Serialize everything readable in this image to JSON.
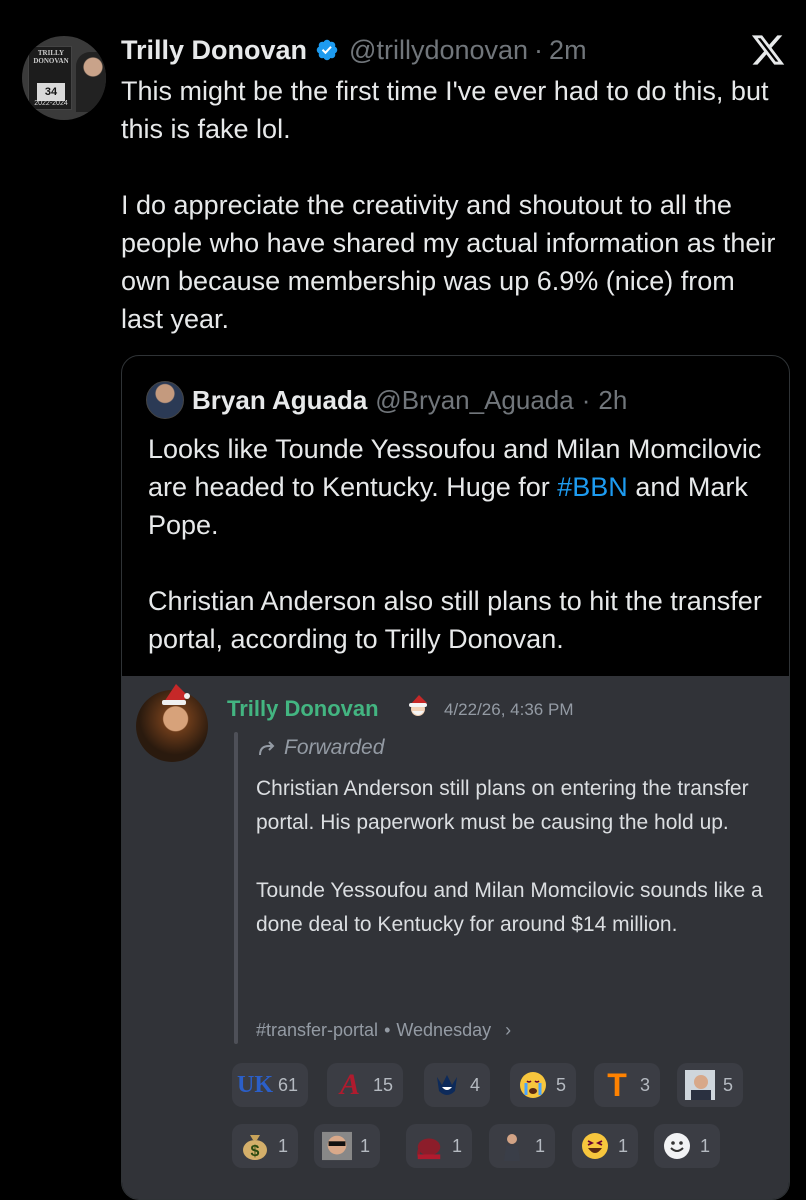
{
  "tweet": {
    "author_name": "Trilly Donovan",
    "handle": "@trillydonovan",
    "separator": "·",
    "time": "2m",
    "text": "This might be the first time I've ever had to do this, but this is fake lol.\n\nI do appreciate the creativity and shoutout to all the people who have shared my actual information as their own because membership was up 6.9% (nice) from last year.",
    "avatar_text": {
      "top": "TRILLY DONOVAN",
      "number": "34",
      "years": "2022-2024"
    }
  },
  "quote": {
    "author_name": "Bryan Aguada",
    "handle": "@Bryan_Aguada",
    "separator": "·",
    "time": "2h",
    "text_part1": "Looks like Tounde Yessoufou and Milan Momcilovic are headed to Kentucky. Huge for ",
    "hashtag": "#BBN",
    "text_part2": " and Mark Pope.",
    "text_para2": "Christian Anderson also still plans to hit the transfer portal, according to Trilly Donovan."
  },
  "discord": {
    "author_name": "Trilly Donovan",
    "timestamp": "4/22/26, 4:36 PM",
    "forwarded_label": "Forwarded",
    "body": "Christian Anderson still plans on entering the transfer portal. His paperwork must be causing the hold up.\n\nTounde Yessoufou and Milan Momcilovic sounds like a done deal to Kentucky for around $14 million.",
    "channel": "#transfer-portal",
    "bullet": "•",
    "day": "Wednesday",
    "chevron": "›",
    "reactions": [
      {
        "icon": "uk-logo-icon",
        "count": "61"
      },
      {
        "icon": "alabama-logo-icon",
        "count": "15"
      },
      {
        "icon": "uconn-husky-icon",
        "count": "4"
      },
      {
        "icon": "crying-face-icon",
        "count": "5"
      },
      {
        "icon": "tennessee-logo-icon",
        "count": "3"
      },
      {
        "icon": "coach-face-icon",
        "count": "5"
      },
      {
        "icon": "money-bag-icon",
        "count": "1"
      },
      {
        "icon": "sunglasses-man-icon",
        "count": "1"
      },
      {
        "icon": "alabama-elephant-icon",
        "count": "1"
      },
      {
        "icon": "coach-standing-icon",
        "count": "1"
      },
      {
        "icon": "laughing-face-icon",
        "count": "1"
      },
      {
        "icon": "smiley-icon",
        "count": "1"
      }
    ],
    "reaction_emoji": {
      "uk": "UK",
      "alabama": "A",
      "tennessee": "T",
      "money": "$"
    }
  },
  "colors": {
    "background": "#000000",
    "text": "#e7e9ea",
    "muted": "#71767b",
    "link": "#1d9bf0",
    "verified": "#1d9bf0",
    "discord_bg": "#313338",
    "discord_name": "#43b581",
    "reaction_bg": "#3b3d44"
  }
}
